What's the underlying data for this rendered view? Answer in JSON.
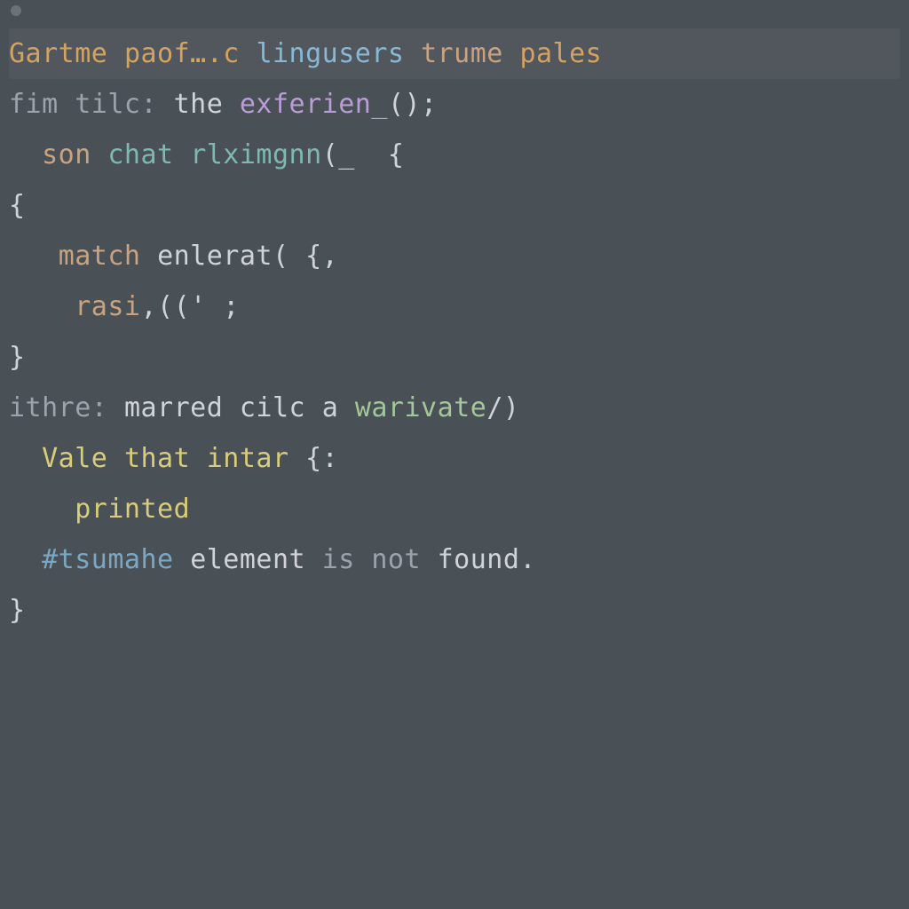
{
  "line1": {
    "t1": "Gartme ",
    "t2": "paof….c ",
    "t3": "lingusers ",
    "t4": "trume ",
    "t5": "pales"
  },
  "line2": {
    "t1": "fim tilc: ",
    "t2": "the ",
    "t3": "exferien_",
    "t4": "();"
  },
  "line3": {
    "t1": "  ",
    "t2": "son ",
    "t3": "chat ",
    "t4": "rlximgnn",
    "t5": "(_  {"
  },
  "line4": {
    "t1": "{"
  },
  "line5": {
    "t1": "   ",
    "t2": "match ",
    "t3": "enlerat( {,"
  },
  "line6": {
    "t1": "    ",
    "t2": "rasi",
    "t3": ",((' ;"
  },
  "line7": {
    "t1": "}"
  },
  "line8": {
    "t1": ""
  },
  "line9": {
    "t1": "ithre: ",
    "t2": "marred ",
    "t3": "cilc ",
    "t4": "a ",
    "t5": "warivate",
    "t6": "/)"
  },
  "line10": {
    "t1": "  ",
    "t2": "Vale ",
    "t3": "that ",
    "t4": "intar ",
    "t5": "{:"
  },
  "line11": {
    "t1": "    ",
    "t2": "printed"
  },
  "line12": {
    "t1": ""
  },
  "line13": {
    "t1": "  ",
    "t2": "#tsumahe ",
    "t3": "element ",
    "t4": "is ",
    "t5": "not ",
    "t6": "found."
  },
  "line14": {
    "t1": "}"
  }
}
